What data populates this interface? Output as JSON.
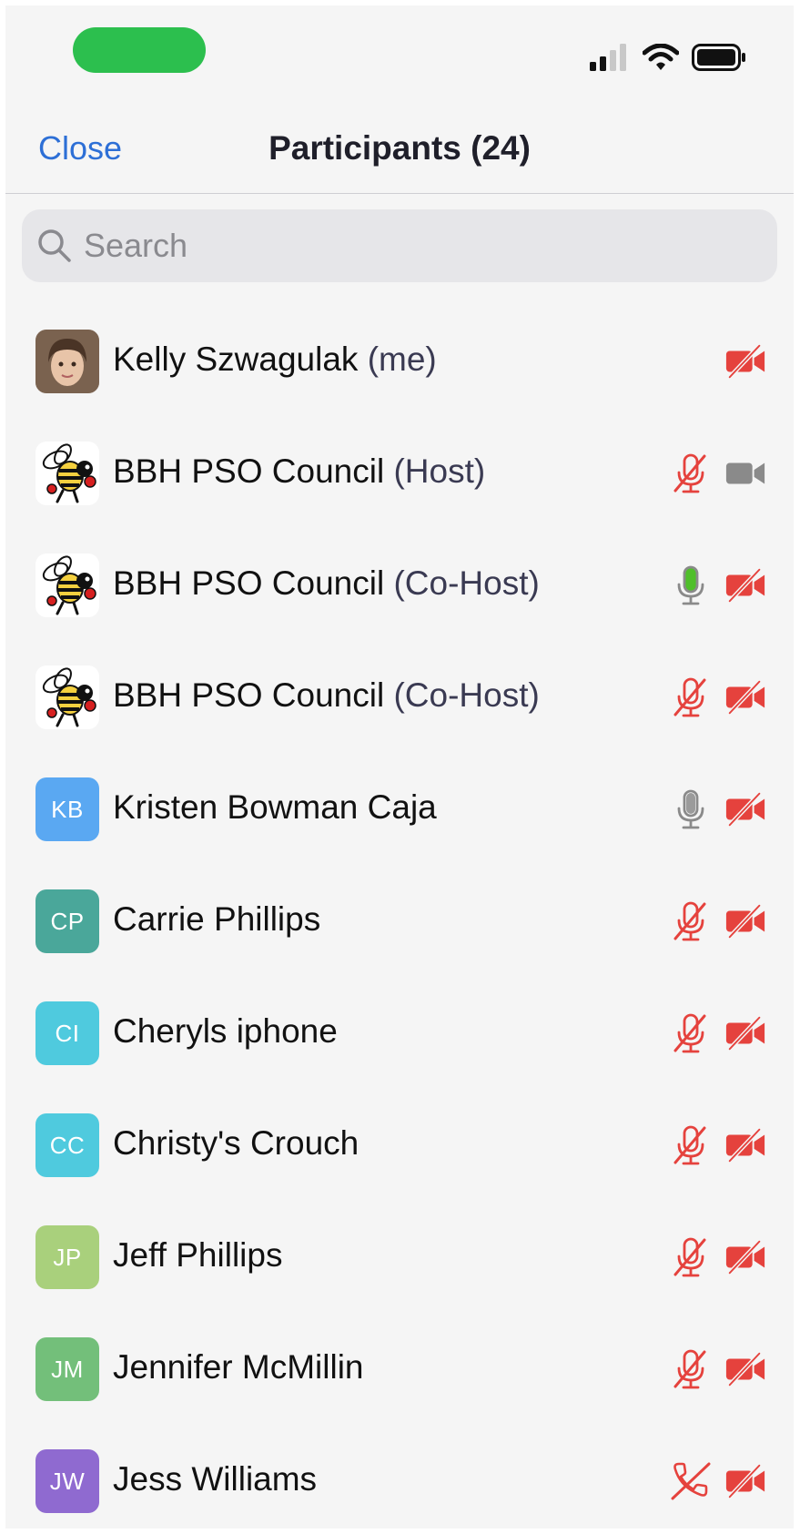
{
  "header": {
    "close_label": "Close",
    "title": "Participants (24)"
  },
  "search": {
    "placeholder": "Search"
  },
  "colors": {
    "accent": "#2d6fd6",
    "muted_red": "#e5423d",
    "unmuted_green": "#4fbf2a",
    "icon_gray": "#8a8a8a",
    "call_pill": "#2cbf4e"
  },
  "participants": [
    {
      "name": "Kelly Szwagulak",
      "role": "(me)",
      "initials": "",
      "avatar": "photo",
      "avatar_color": "#a0856e",
      "audio": "none",
      "video": "off"
    },
    {
      "name": "BBH PSO Council",
      "role": "(Host)",
      "initials": "",
      "avatar": "bee-logo",
      "avatar_color": "#ffffff",
      "audio": "muted",
      "video": "on"
    },
    {
      "name": "BBH PSO Council",
      "role": "(Co-Host)",
      "initials": "",
      "avatar": "bee-logo",
      "avatar_color": "#ffffff",
      "audio": "speaking",
      "video": "off"
    },
    {
      "name": "BBH PSO Council",
      "role": "(Co-Host)",
      "initials": "",
      "avatar": "bee-logo",
      "avatar_color": "#ffffff",
      "audio": "muted",
      "video": "off"
    },
    {
      "name": "Kristen Bowman Caja",
      "role": "",
      "initials": "KB",
      "avatar": "initials",
      "avatar_color": "#5aa8f2",
      "audio": "unmuted",
      "video": "off"
    },
    {
      "name": "Carrie Phillips",
      "role": "",
      "initials": "CP",
      "avatar": "initials",
      "avatar_color": "#4aa79a",
      "audio": "muted",
      "video": "off"
    },
    {
      "name": "Cheryls iphone",
      "role": "",
      "initials": "CI",
      "avatar": "initials",
      "avatar_color": "#4fcade",
      "audio": "muted",
      "video": "off"
    },
    {
      "name": "Christy's Crouch",
      "role": "",
      "initials": "CC",
      "avatar": "initials",
      "avatar_color": "#4fcade",
      "audio": "muted",
      "video": "off"
    },
    {
      "name": "Jeff Phillips",
      "role": "",
      "initials": "JP",
      "avatar": "initials",
      "avatar_color": "#a9d07c",
      "audio": "muted",
      "video": "off"
    },
    {
      "name": "Jennifer McMillin",
      "role": "",
      "initials": "JM",
      "avatar": "initials",
      "avatar_color": "#73bf7a",
      "audio": "muted",
      "video": "off"
    },
    {
      "name": "Jess Williams",
      "role": "",
      "initials": "JW",
      "avatar": "initials",
      "avatar_color": "#8f6ad0",
      "audio": "phone-off",
      "video": "off"
    }
  ]
}
